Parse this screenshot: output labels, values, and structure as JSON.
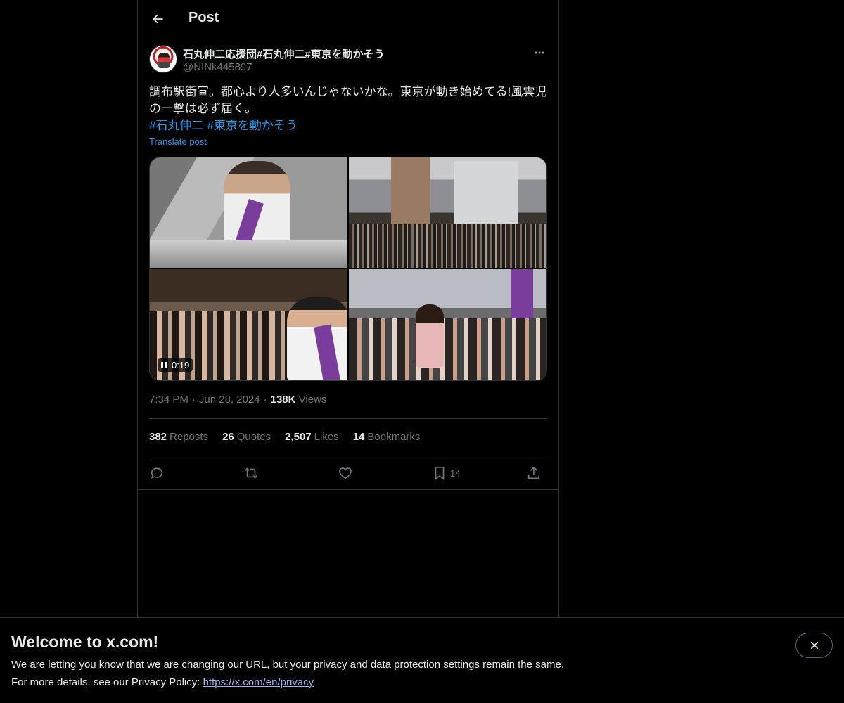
{
  "header": {
    "title": "Post"
  },
  "author": {
    "display_name": "石丸伸二応援団#石丸伸二#東京を動かそう",
    "handle": "@NINk445897"
  },
  "post": {
    "text": "調布駅街宣。都心より人多いんじゃないかな。東京が動き始めてる!風雲児の一撃は必ず届く。",
    "hashtags": [
      "#石丸伸二",
      "#東京を動かそう"
    ],
    "translate_label": "Translate post",
    "video_duration": "0:19",
    "time": "7:34 PM",
    "date": "Jun 28, 2024",
    "views_count": "138K",
    "views_label": "Views"
  },
  "stats": {
    "reposts_count": "382",
    "reposts_label": "Reposts",
    "quotes_count": "26",
    "quotes_label": "Quotes",
    "likes_count": "2,507",
    "likes_label": "Likes",
    "bookmarks_count": "14",
    "bookmarks_label": "Bookmarks"
  },
  "actions": {
    "reply_icon": "reply-icon",
    "repost_icon": "repost-icon",
    "like_icon": "heart-icon",
    "bookmark_icon": "bookmark-icon",
    "bookmark_count": "14",
    "share_icon": "share-icon"
  },
  "banner": {
    "title": "Welcome to x.com!",
    "line1": "We are letting you know that we are changing our URL, but your privacy and data protection settings remain the same.",
    "line2_prefix": "For more details, see our Privacy Policy: ",
    "link_text": "https://x.com/en/privacy"
  },
  "colors": {
    "background": "#000000",
    "text": "#e7e9ea",
    "muted": "#71767b",
    "accent": "#1d9bf0",
    "border": "#2f3336"
  }
}
